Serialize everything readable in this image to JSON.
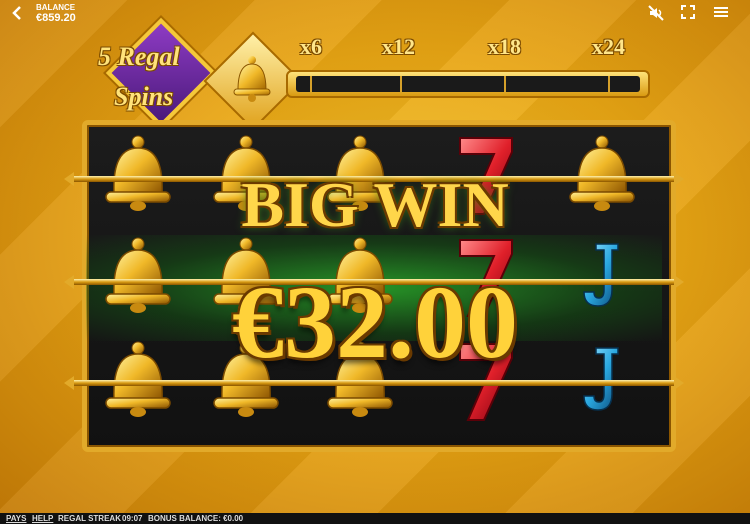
{
  "topbar": {
    "back_icon": "chevron-left-icon",
    "balance_label": "BALANCE",
    "balance_value": "€859.20",
    "icons": [
      "mute-icon",
      "fullscreen-icon",
      "menu-icon"
    ]
  },
  "logo": {
    "line1": "5 Regal",
    "line2": "Spins"
  },
  "streak": {
    "multipliers": [
      "x6",
      "x12",
      "x18",
      "x24"
    ],
    "progress": 0
  },
  "reels": {
    "grid": [
      [
        "bell",
        "bell",
        "bell",
        "seven",
        "bell"
      ],
      [
        "bell",
        "bell",
        "bell",
        "seven",
        "jack"
      ],
      [
        "bell",
        "bell",
        "bell",
        "seven",
        "jack"
      ]
    ]
  },
  "win": {
    "title": "BIG WIN",
    "amount": "€32.00"
  },
  "bottombar": {
    "pays": "PAYS",
    "help": "HELP",
    "game": "REGAL STREAK",
    "time": "09:07",
    "bonus_balance": "BONUS BALANCE: €0.00"
  },
  "colors": {
    "gold": "#e2aa2a",
    "purple": "#6a2aa0",
    "green_glow": "#28a028",
    "seven_red": "#e0202a",
    "jack_blue": "#2aa8e0"
  }
}
